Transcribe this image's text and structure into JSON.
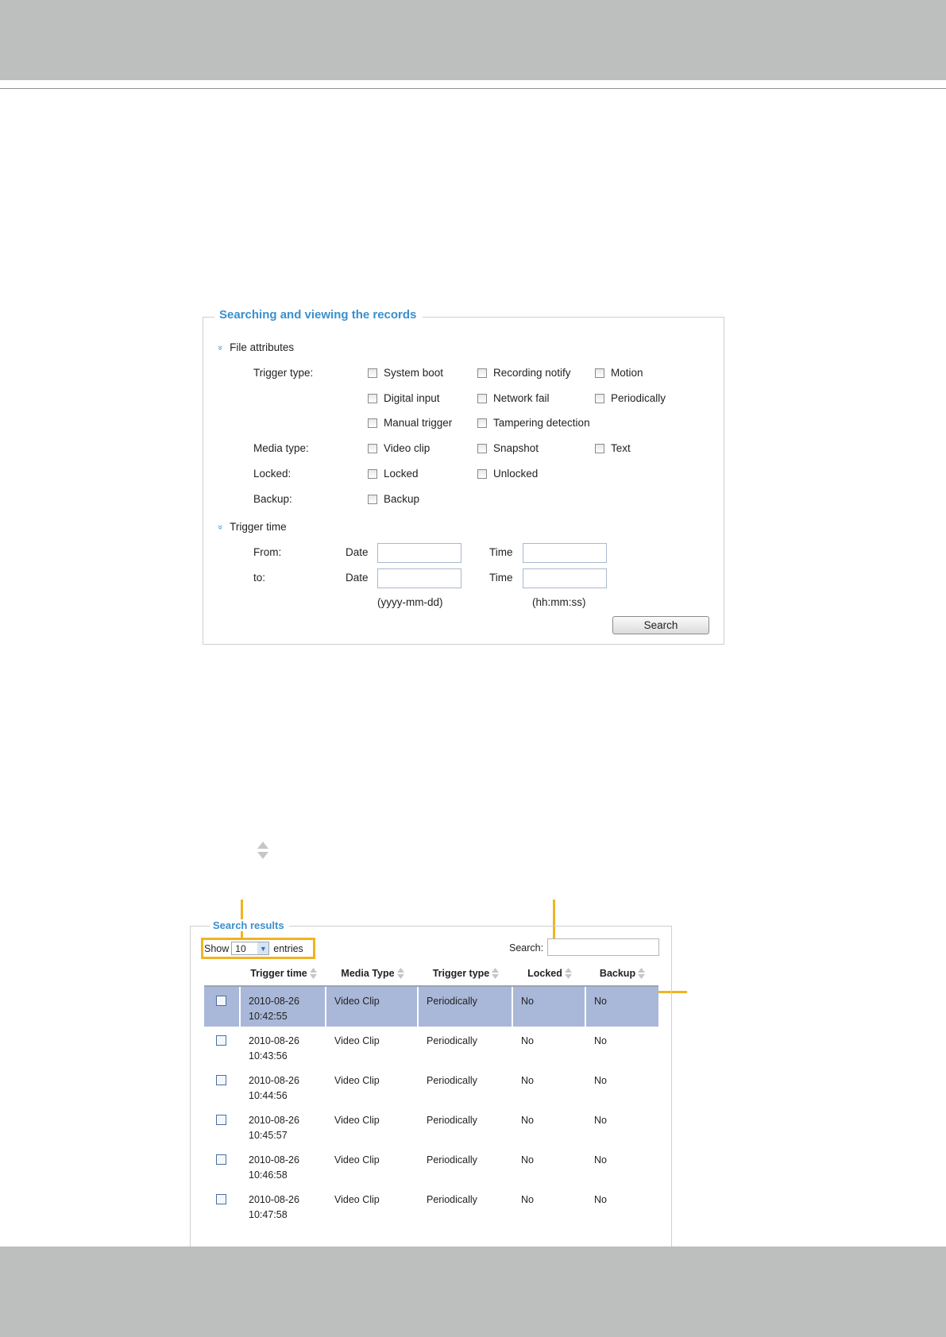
{
  "search_panel": {
    "title": "Searching and viewing the records",
    "file_attributes": {
      "heading": "File attributes",
      "trigger_type_label": "Trigger type:",
      "trigger_types": [
        "System boot",
        "Recording notify",
        "Motion",
        "Digital input",
        "Network fail",
        "Periodically",
        "Manual trigger",
        "Tampering detection"
      ],
      "media_type_label": "Media type:",
      "media_types": [
        "Video clip",
        "Snapshot",
        "Text"
      ],
      "locked_label": "Locked:",
      "locked_options": [
        "Locked",
        "Unlocked"
      ],
      "backup_label": "Backup:",
      "backup_options": [
        "Backup"
      ]
    },
    "trigger_time": {
      "heading": "Trigger time",
      "from_label": "From:",
      "to_label": "to:",
      "date_label": "Date",
      "time_label": "Time",
      "date_format": "(yyyy-mm-dd)",
      "time_format": "(hh:mm:ss)",
      "from_date": "",
      "from_time": "",
      "to_date": "",
      "to_time": ""
    },
    "search_button": "Search"
  },
  "results_panel": {
    "title": "Search results",
    "show_label": "Show",
    "entries_value": "10",
    "entries_label": "entries",
    "search_label": "Search:",
    "search_value": "",
    "columns": [
      "Trigger time",
      "Media Type",
      "Trigger type",
      "Locked",
      "Backup"
    ],
    "rows": [
      {
        "date": "2010-08-26",
        "time": "10:42:55",
        "media": "Video Clip",
        "trigger": "Periodically",
        "locked": "No",
        "backup": "No",
        "selected": true
      },
      {
        "date": "2010-08-26",
        "time": "10:43:56",
        "media": "Video Clip",
        "trigger": "Periodically",
        "locked": "No",
        "backup": "No",
        "selected": false
      },
      {
        "date": "2010-08-26",
        "time": "10:44:56",
        "media": "Video Clip",
        "trigger": "Periodically",
        "locked": "No",
        "backup": "No",
        "selected": false
      },
      {
        "date": "2010-08-26",
        "time": "10:45:57",
        "media": "Video Clip",
        "trigger": "Periodically",
        "locked": "No",
        "backup": "No",
        "selected": false
      },
      {
        "date": "2010-08-26",
        "time": "10:46:58",
        "media": "Video Clip",
        "trigger": "Periodically",
        "locked": "No",
        "backup": "No",
        "selected": false
      },
      {
        "date": "2010-08-26",
        "time": "10:47:58",
        "media": "Video Clip",
        "trigger": "Periodically",
        "locked": "No",
        "backup": "No",
        "selected": false
      }
    ]
  },
  "colors": {
    "accent": "#3a8fce",
    "callout": "#f0b323",
    "selected_row": "#a9b7d8",
    "band": "#bdbfbe"
  }
}
